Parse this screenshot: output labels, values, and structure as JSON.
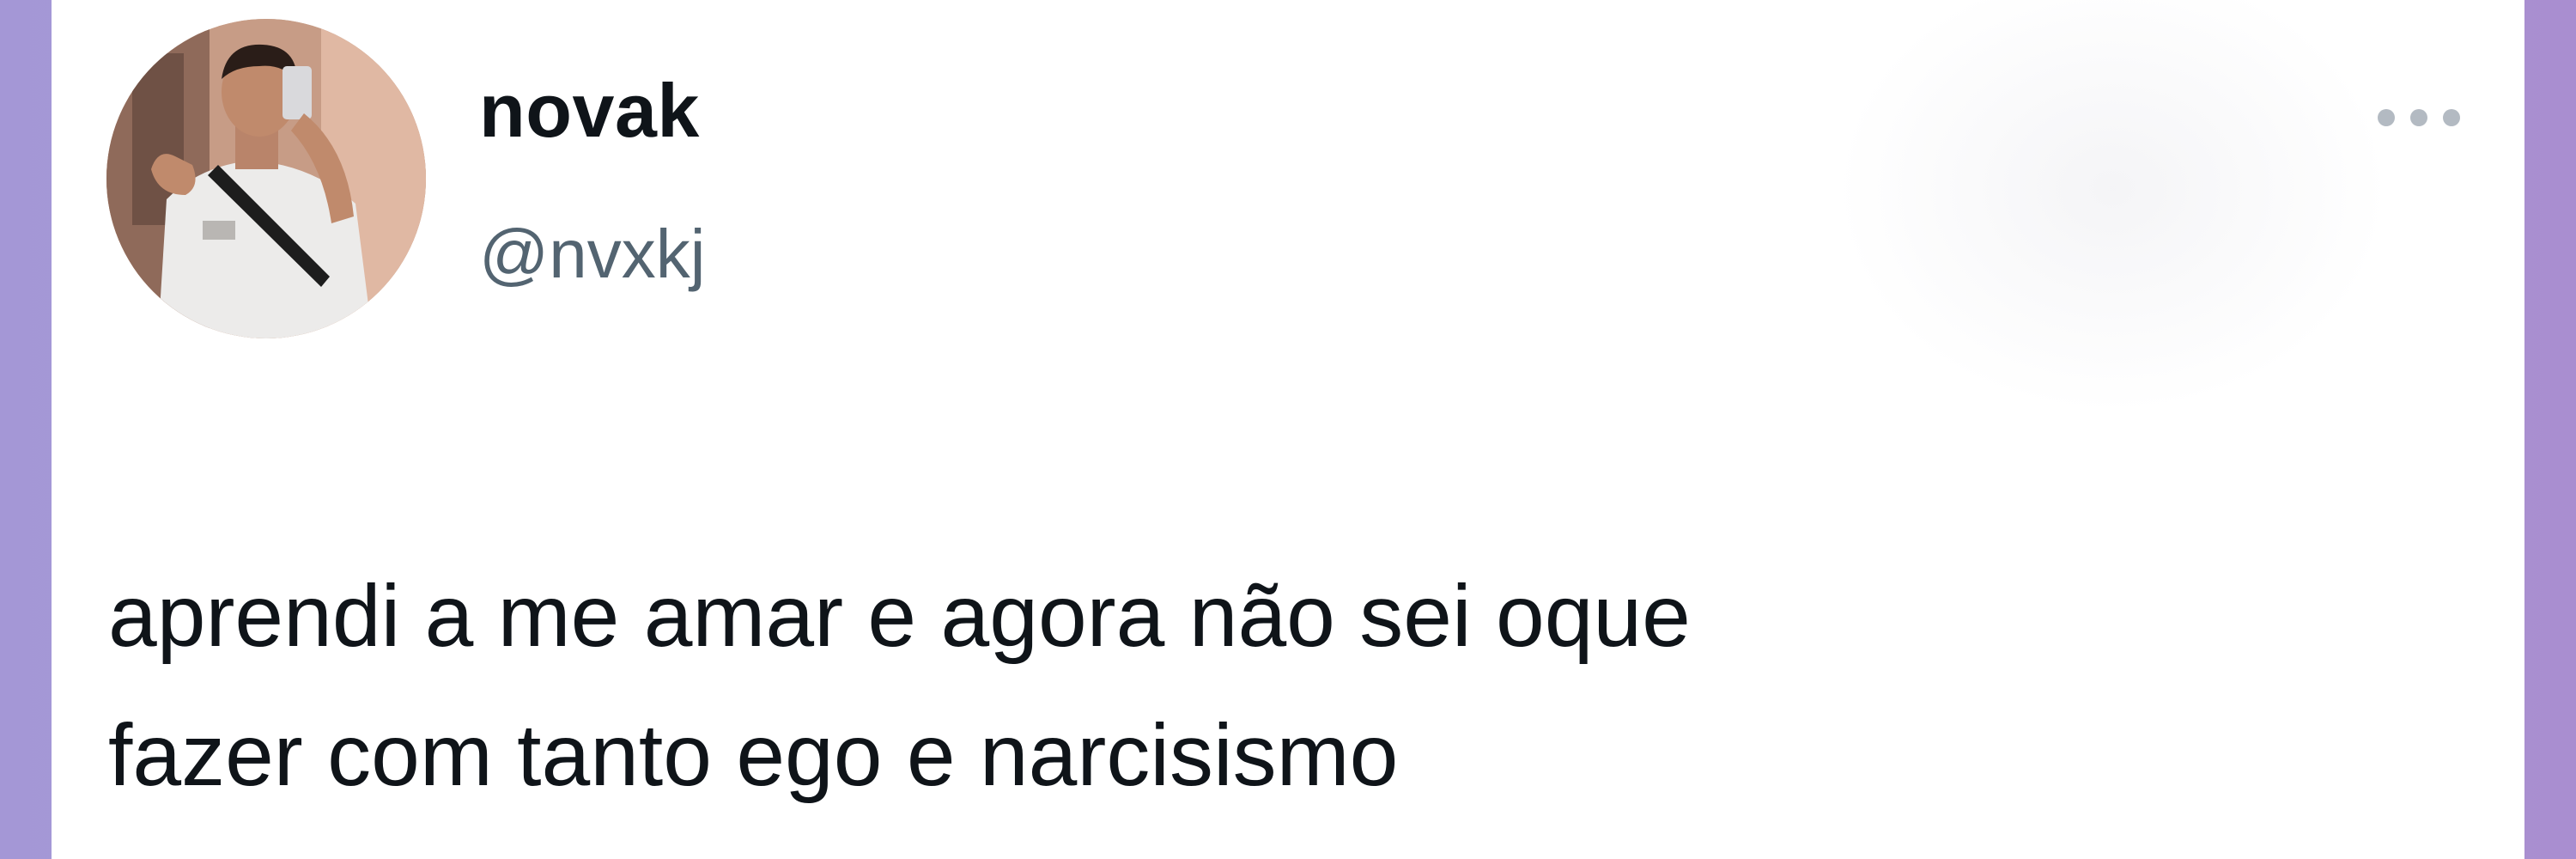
{
  "tweet": {
    "author": {
      "display_name": "novak",
      "handle": "@nvxkj",
      "avatar_icon": "profile-photo"
    },
    "more_icon": "more-horizontal-icon",
    "text": "aprendi a me amar e agora não sei oque\nfazer com tanto ego e narcisismo"
  },
  "colors": {
    "background": "#a497d6",
    "card": "#ffffff",
    "primary_text": "#0f1419",
    "secondary_text": "#536471"
  }
}
